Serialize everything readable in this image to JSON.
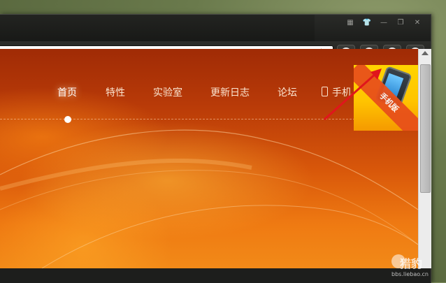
{
  "window": {
    "controls": [
      "▦",
      "👕",
      "—",
      "❐",
      "✕"
    ]
  },
  "toolbar": {
    "address_value": "",
    "buttons": [
      "favorites",
      "download",
      "screenshot",
      "menu"
    ]
  },
  "nav": {
    "items": [
      {
        "label": "首页",
        "active": true
      },
      {
        "label": "特性",
        "active": false
      },
      {
        "label": "实验室",
        "active": false
      },
      {
        "label": "更新日志",
        "active": false
      },
      {
        "label": "论坛",
        "active": false
      },
      {
        "label": "手机",
        "active": false
      }
    ]
  },
  "promo": {
    "label": "手机版"
  },
  "watermark": {
    "name": "猎豹",
    "url": "bbs.liebao.cn"
  },
  "colors": {
    "accent_orange": "#e8501a",
    "promo_yellow": "#ffd400",
    "page_top": "#a02b05",
    "page_bottom": "#f28a18"
  }
}
